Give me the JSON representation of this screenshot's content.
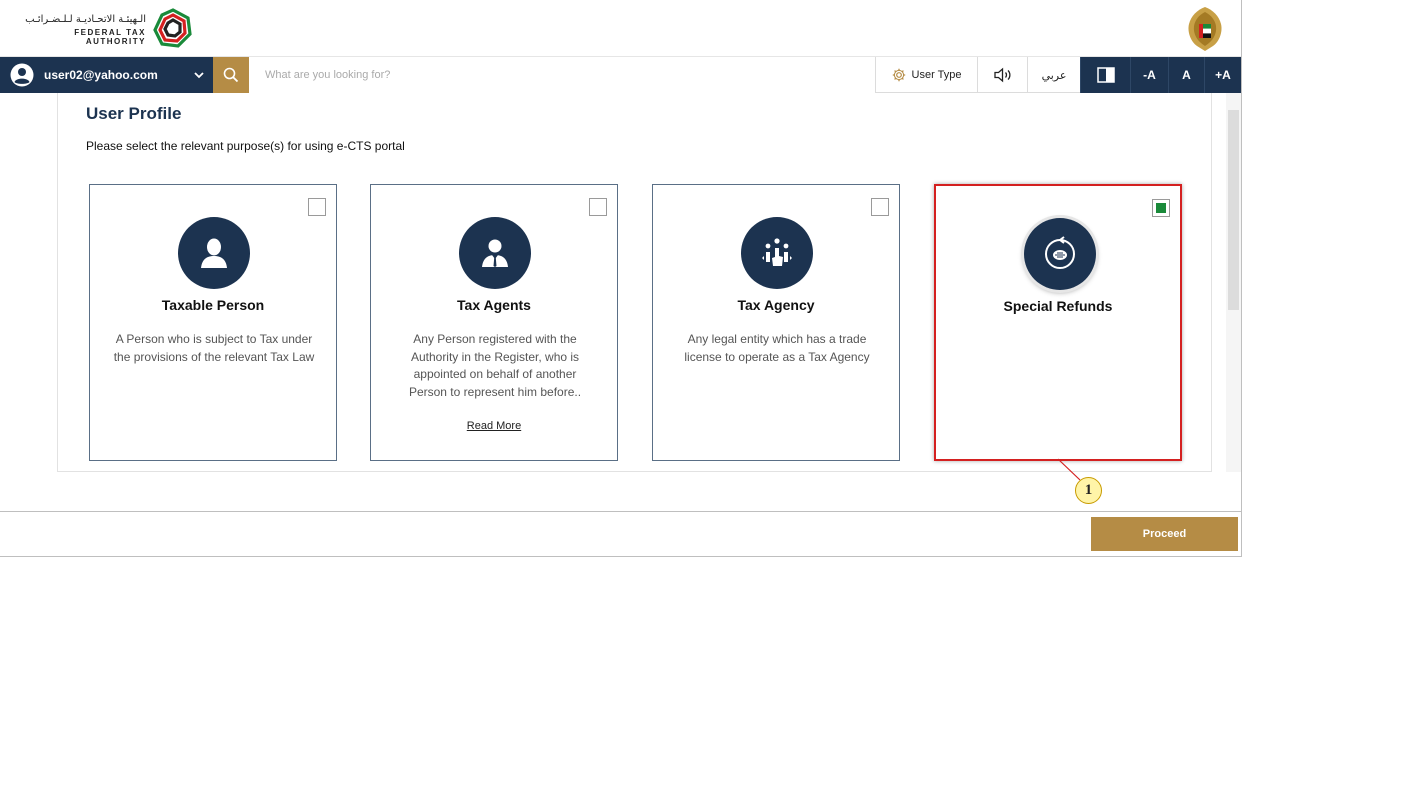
{
  "header": {
    "logo_arabic": "الـهيئـة الاتحـاديـة لـلـضـرائـب",
    "logo_english": "FEDERAL TAX AUTHORITY"
  },
  "nav": {
    "user_email": "user02@yahoo.com",
    "search_placeholder": "What are you looking for?",
    "user_type_label": "User Type",
    "lang_label": "عربي",
    "font_minus": "-A",
    "font_normal": "A",
    "font_plus": "+A"
  },
  "main": {
    "title": "User Profile",
    "subtitle": "Please select the relevant purpose(s) for using e-CTS portal",
    "cards": [
      {
        "title": "Taxable Person",
        "description": "A Person who is subject to Tax under the provisions of the relevant Tax Law",
        "checked": false,
        "icon": "person-icon"
      },
      {
        "title": "Tax Agents",
        "description": "Any Person registered with the Authority in the Register, who is appointed on behalf of another Person to represent him before..",
        "read_more": "Read More",
        "checked": false,
        "icon": "agent-icon"
      },
      {
        "title": "Tax Agency",
        "description": "Any legal entity which has a trade license to operate as a Tax Agency",
        "checked": false,
        "icon": "agency-icon"
      },
      {
        "title": "Special Refunds",
        "description": "",
        "checked": true,
        "icon": "refund-icon"
      }
    ]
  },
  "callout": {
    "number": "1"
  },
  "footer": {
    "proceed_label": "Proceed"
  },
  "colors": {
    "navy": "#1c3350",
    "gold": "#b58c45",
    "highlight": "#d42020",
    "check": "#1a8a3a"
  }
}
